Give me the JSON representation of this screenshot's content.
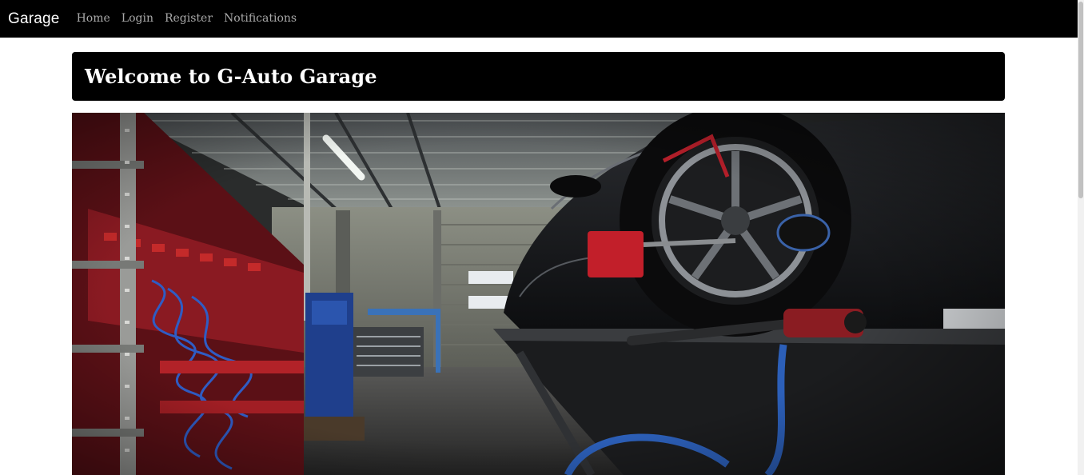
{
  "navbar": {
    "brand": "Garage",
    "links": [
      "Home",
      "Login",
      "Register",
      "Notifications"
    ]
  },
  "jumbotron": {
    "title": "Welcome to G-Auto Garage"
  },
  "hero": {
    "alt": "Car on lift in auto repair garage"
  },
  "colors": {
    "navbar_bg": "#000000",
    "brand_text": "#ffffff",
    "link_text": "#a9a9a9",
    "jumbotron_bg": "#000000"
  }
}
